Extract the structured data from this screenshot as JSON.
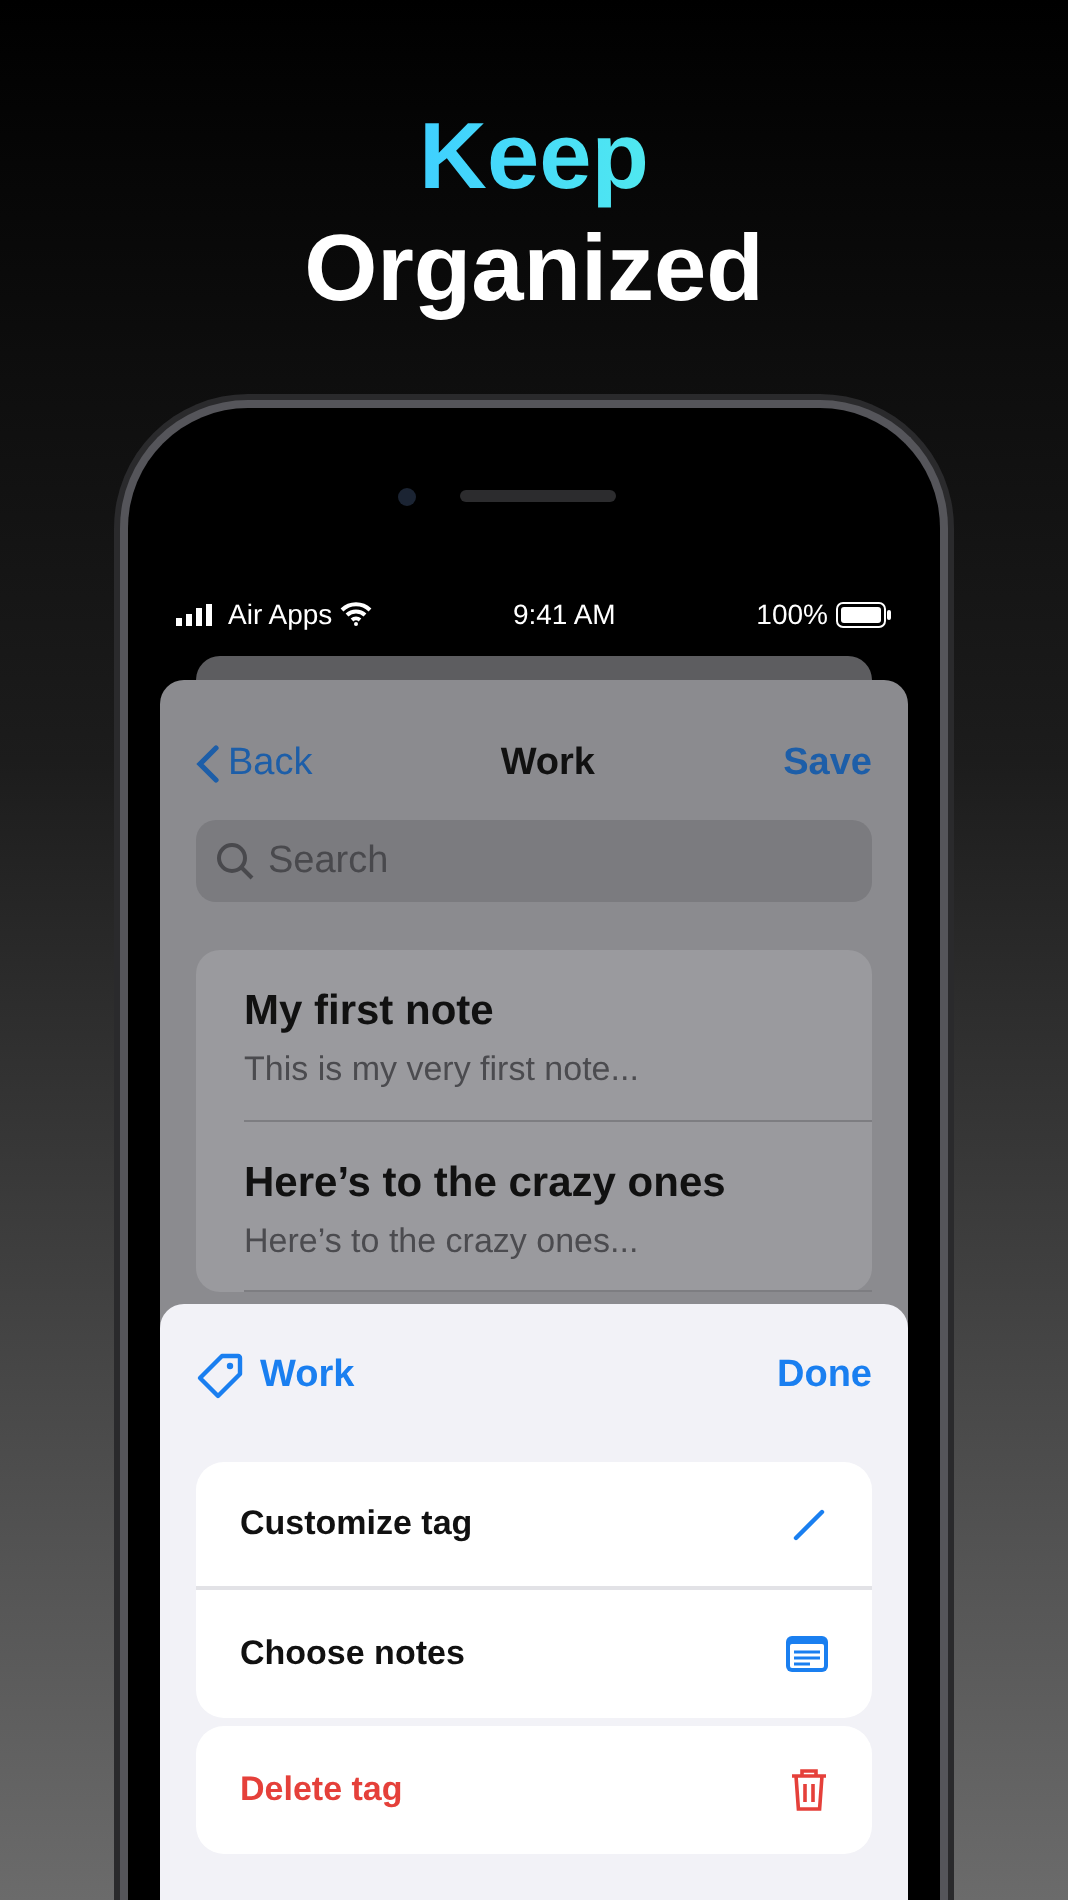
{
  "headline": {
    "line_1": "Keep",
    "line_2": "Organized"
  },
  "status_bar": {
    "carrier": "Air Apps",
    "time": "9:41 AM",
    "battery": "100%"
  },
  "nav": {
    "back": "Back",
    "title": "Work",
    "action": "Save"
  },
  "search": {
    "placeholder": "Search"
  },
  "notes": [
    {
      "title": "My first note",
      "preview": "This is my very first note..."
    },
    {
      "title": "Here’s to the crazy ones",
      "preview": "Here’s to the crazy ones..."
    }
  ],
  "sheet": {
    "tag": "Work",
    "done": "Done",
    "action_groups": [
      [
        {
          "label": "Customize tag",
          "kind": "edit",
          "destructive": false
        },
        {
          "label": "Choose notes",
          "kind": "notes",
          "destructive": false
        }
      ],
      [
        {
          "label": "Delete tag",
          "kind": "delete",
          "destructive": true
        }
      ]
    ]
  }
}
